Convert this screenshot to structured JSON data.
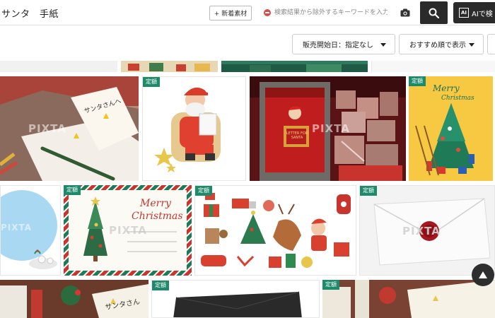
{
  "search": {
    "query": "サンタ　手紙",
    "new_label": "+ 新着素材",
    "exclude_placeholder": "検索結果から除外するキーワードを入力",
    "ai_label": "AIで検"
  },
  "filters": {
    "sale_start": "販売開始日：指定なし",
    "sort": "おすすめ順で表示"
  },
  "badges": {
    "fixed_price": "定額"
  },
  "watermark": "PIXTA",
  "tiles": {
    "letter_note_text": "サンタさんへ",
    "postbox_sign": "LETTER FOR SANTA",
    "card_merry": "Merry",
    "card_christmas": "Christmas",
    "yellow_merry": "Merry",
    "yellow_christmas": "Christmas",
    "bottom_note_text": "サンタさん"
  },
  "colors": {
    "badge": "#1f8a6b",
    "search_button": "#2a2a2a",
    "exclude_icon": "#d94b4b"
  }
}
